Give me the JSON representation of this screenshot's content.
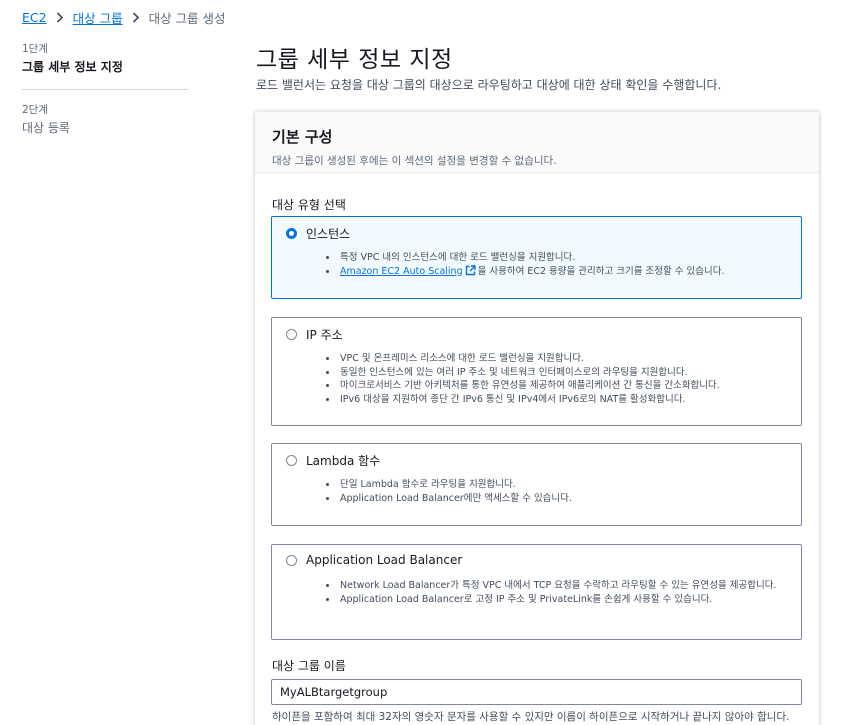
{
  "breadcrumb": {
    "items": [
      "EC2",
      "대상 그룹"
    ],
    "current": "대상 그룹 생성"
  },
  "steps": [
    {
      "number": "1단계",
      "title": "그룹 세부 정보 지정"
    },
    {
      "number": "2단계",
      "title": "대상 등록"
    }
  ],
  "page": {
    "title": "그룹 세부 정보 지정",
    "description": "로드 밸런서는 요청을 대상 그룹의 대상으로 라우팅하고 대상에 대한 상태 확인을 수행합니다."
  },
  "panel": {
    "title": "기본 구성",
    "description": "대상 그룹이 생성된 후에는 이 섹션의 설정을 변경할 수 없습니다."
  },
  "target_type": {
    "label": "대상 유형 선택",
    "selected": "인스턴스",
    "options": [
      {
        "title": "인스턴스",
        "bullets": [
          "특정 VPC 내의 인스턴스에 대한 로드 밸런싱을 지원합니다."
        ],
        "link_text": "Amazon EC2 Auto Scaling",
        "link_suffix": "을 사용하여 EC2 용량을 관리하고 크기를 조정할 수 있습니다."
      },
      {
        "title": "IP 주소",
        "bullets": [
          "VPC 및 온프레미스 리소스에 대한 로드 밸런싱을 지원합니다.",
          "동일한 인스턴스에 있는 여러 IP 주소 및 네트워크 인터페이스로의 라우팅을 지원합니다.",
          "마이크로서비스 기반 아키텍처를 통한 유연성을 제공하여 애플리케이션 간 통신을 간소화합니다.",
          "IPv6 대상을 지원하여 종단 간 IPv6 통신 및 IPv4에서 IPv6로의 NAT를 활성화합니다."
        ]
      },
      {
        "title": "Lambda 함수",
        "bullets": [
          "단일 Lambda 함수로 라우팅을 지원합니다.",
          "Application Load Balancer에만 액세스할 수 있습니다."
        ]
      },
      {
        "title": "Application Load Balancer",
        "bullets": [
          "Network Load Balancer가 특정 VPC 내에서 TCP 요청을 수락하고 라우팅할 수 있는 유연성을 제공합니다.",
          "Application Load Balancer로 고정 IP 주소 및 PrivateLink를 손쉽게 사용할 수 있습니다."
        ]
      }
    ]
  },
  "group_name": {
    "label": "대상 그룹 이름",
    "value": "MyALBtargetgroup",
    "hint": "하이픈을 포함하여 최대 32자의 영숫자 문자를 사용할 수 있지만 이름이 하이픈으로 시작하거나 끝나지 않아야 합니다."
  },
  "colors": {
    "link": "#0972d3",
    "selected_border": "#0972d3",
    "selected_bg": "#f1faff",
    "text": "#16191f",
    "muted": "#5f6b7a"
  }
}
